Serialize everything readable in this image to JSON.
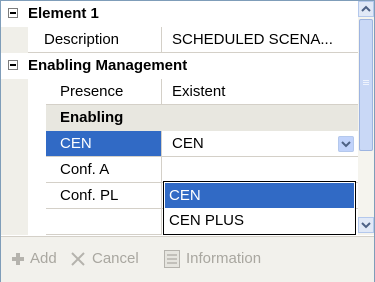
{
  "grid": {
    "element": {
      "title": "Element 1",
      "description_label": "Description",
      "description_value": "SCHEDULED SCENA..."
    },
    "enabling_management": {
      "title": "Enabling Management",
      "presence_label": "Presence",
      "presence_value": "Existent",
      "enabling": {
        "title": "Enabling",
        "cen_label": "CEN",
        "cen_value": "CEN",
        "conf_a_label": "Conf. A",
        "conf_pl_label": "Conf. PL"
      }
    }
  },
  "dropdown": {
    "options": [
      "CEN",
      "CEN PLUS"
    ],
    "selected": "CEN"
  },
  "toolbar": {
    "add_label": "Add",
    "cancel_label": "Cancel",
    "information_label": "Information"
  },
  "colors": {
    "selection": "#316ac5",
    "category_bg": "#e8e7e0",
    "disabled_text": "#a9a7a0"
  }
}
